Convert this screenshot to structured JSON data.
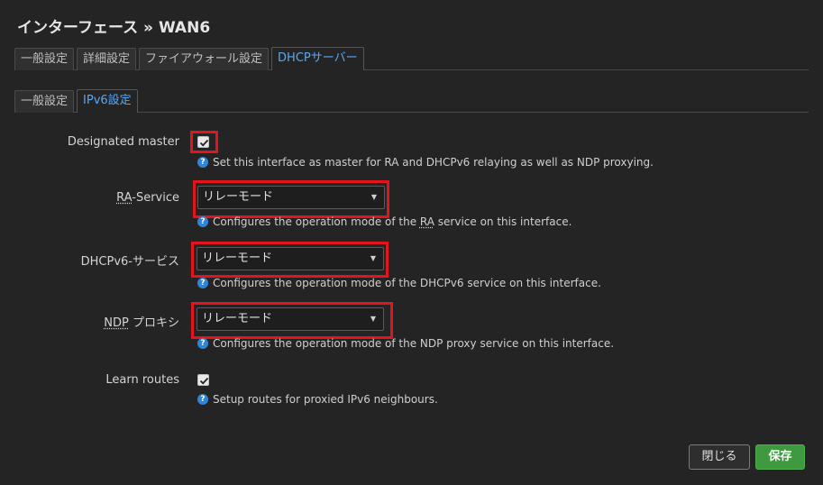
{
  "dialog": {
    "title": "インターフェース » WAN6"
  },
  "tabs_primary": [
    {
      "label": "一般設定",
      "active": false
    },
    {
      "label": "詳細設定",
      "active": false
    },
    {
      "label": "ファイアウォール設定",
      "active": false
    },
    {
      "label": "DHCPサーバー",
      "active": true
    }
  ],
  "tabs_secondary": [
    {
      "label": "一般設定",
      "active": false
    },
    {
      "label": "IPv6設定",
      "active": true
    }
  ],
  "fields": {
    "designated_master": {
      "label": "Designated master",
      "checked": true,
      "help": "Set this interface as master for RA and DHCPv6 relaying as well as NDP proxying."
    },
    "ra_service": {
      "label_abbr": "RA",
      "label_rest": "-Service",
      "value": "リレーモード",
      "help_before": "Configures the operation mode of the ",
      "help_abbr": "RA",
      "help_after": " service on this interface."
    },
    "dhcpv6_service": {
      "label": "DHCPv6-サービス",
      "value": "リレーモード",
      "help": "Configures the operation mode of the DHCPv6 service on this interface."
    },
    "ndp_proxy": {
      "label_abbr": "NDP",
      "label_rest": " プロキシ",
      "value": "リレーモード",
      "help": "Configures the operation mode of the NDP proxy service on this interface."
    },
    "learn_routes": {
      "label": "Learn routes",
      "checked": true,
      "help": "Setup routes for proxied IPv6 neighbours."
    }
  },
  "buttons": {
    "close_label": "閉じる",
    "save_label": "保存"
  },
  "icons": {
    "help": "help-icon",
    "caret": "caret-down-icon",
    "check": "checkmark-icon"
  },
  "colors": {
    "accent": "#5aa9f0",
    "highlight_box": "#e4141f",
    "save_button": "#3f9a3f"
  }
}
